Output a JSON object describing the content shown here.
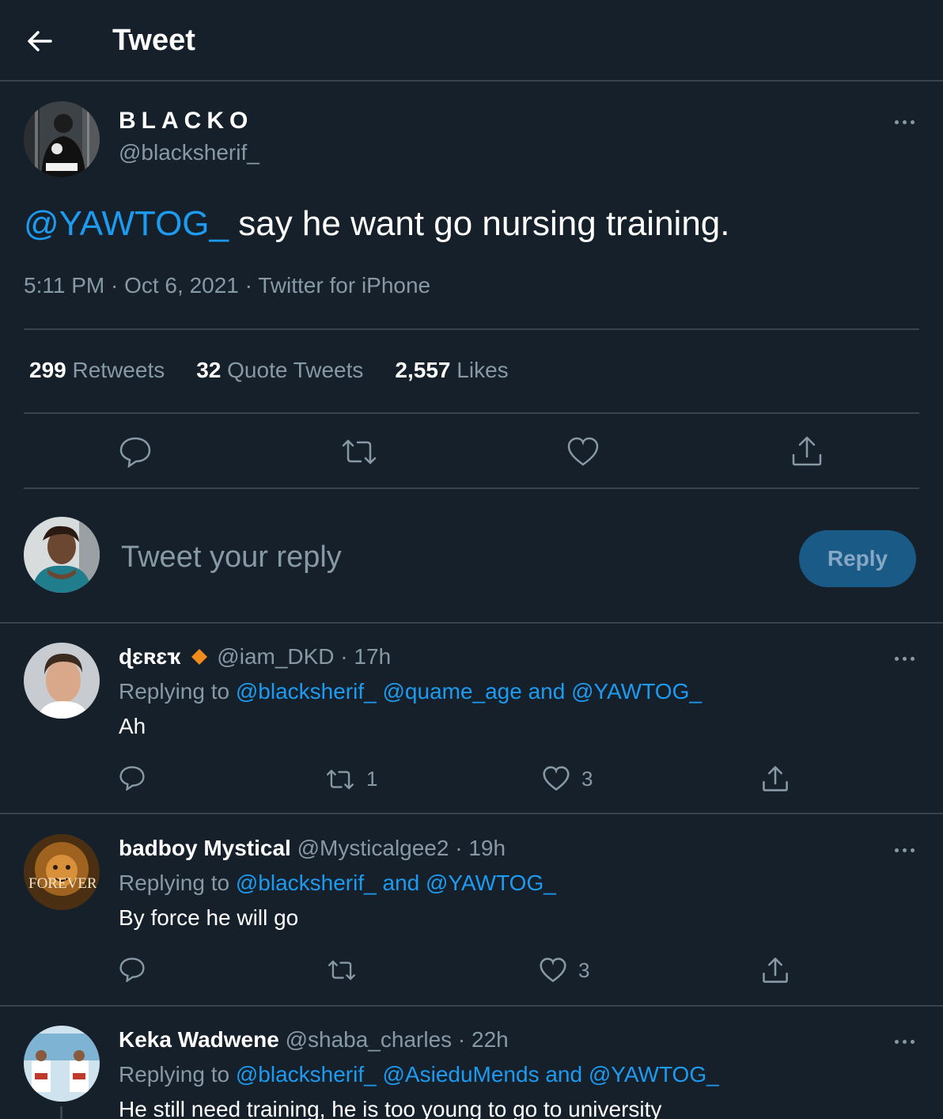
{
  "header": {
    "title": "Tweet",
    "back_icon": "arrow-left-icon"
  },
  "tweet": {
    "author_name": "BLACKO",
    "author_handle": "@blacksherif_",
    "mention": "@YAWTOG_",
    "text": " say he want go nursing training.",
    "time": "5:11 PM",
    "date": "Oct 6, 2021",
    "source": "Twitter for iPhone",
    "sep": " · ",
    "stats": {
      "retweets_count": "299",
      "retweets_label": "Retweets",
      "quotes_count": "32",
      "quotes_label": "Quote Tweets",
      "likes_count": "2,557",
      "likes_label": "Likes"
    }
  },
  "compose": {
    "placeholder": "Tweet your reply",
    "button_label": "Reply"
  },
  "replies": [
    {
      "name": "ɖɛʀɛҡ",
      "verified_badge": "orange-diamond-icon",
      "handle": "@iam_DKD",
      "time": "17h",
      "replying_prefix": "Replying to ",
      "mention_1": "@blacksherif_",
      "mention_2": "@quame_age",
      "mention_3": "@YAWTOG_",
      "and": " and ",
      "text": "Ah",
      "retweet_count": "1",
      "like_count": "3"
    },
    {
      "name": "badboy Mystical",
      "handle": "@Mysticalgee2",
      "time": "19h",
      "replying_prefix": "Replying to ",
      "mention_1": "@blacksherif_",
      "mention_2": "@YAWTOG_",
      "and": " and ",
      "text": "By force he will go",
      "avatar_text": "FOREVER",
      "like_count": "3"
    },
    {
      "name": "Keka Wadwene",
      "handle": "@shaba_charles",
      "time": "22h",
      "replying_prefix": "Replying to ",
      "mention_1": "@blacksherif_",
      "mention_2": "@AsieduMends",
      "mention_3": "@YAWTOG_",
      "and": " and ",
      "text": "He still need training, he is too young to go to  university"
    }
  ],
  "colors": {
    "background": "#15202b",
    "accent": "#1d9bf0",
    "muted": "#8899a6",
    "border": "#38444d",
    "badge": "#f18c1c"
  }
}
